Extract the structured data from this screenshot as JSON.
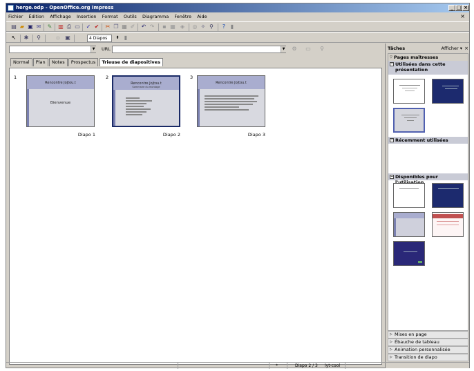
{
  "window": {
    "title": "herge.odp - OpenOffice.org Impress",
    "doc_close": "×",
    "controls": [
      "_",
      "□",
      "×"
    ]
  },
  "menu": [
    "Fichier",
    "Édition",
    "Affichage",
    "Insertion",
    "Format",
    "Outils",
    "Diagramma",
    "Fenêtre",
    "Aide"
  ],
  "toolbar2": {
    "zoom_value": "4 Diapos"
  },
  "hyperlink_bar": {
    "url_label": "URL :",
    "url_value": "",
    "text_value": ""
  },
  "tabs": [
    "Normal",
    "Plan",
    "Notes",
    "Prospectus",
    "Trieuse de diapositives"
  ],
  "active_tab": 4,
  "slides": [
    {
      "number": "1",
      "label": "Diapo 1",
      "title": "Rencontre Jojtou.t",
      "subtitle": "",
      "body": "Bienvenue"
    },
    {
      "number": "2",
      "label": "Diapo 2",
      "title": "Rencontre Jojtou.t",
      "subtitle": "Sommaire du montage",
      "body": ""
    },
    {
      "number": "3",
      "label": "Diapo 3",
      "title": "Rencontre Jojtou.t",
      "subtitle": "",
      "body": ""
    }
  ],
  "slide_selected": 1,
  "task_pane": {
    "title": "Tâches",
    "view_label": "Afficher",
    "close": "×",
    "master_pages": "Pages maîtresses",
    "used_section": "Utilisées dans cette présentation",
    "recent_section": "Récemment utilisées",
    "available_section": "Disponibles pour l'utilisation",
    "bottom_panels": [
      "Mises en page",
      "Ébauche de tableau",
      "Animation personnalisée",
      "Transition de diapo"
    ]
  },
  "status": {
    "modified": "*",
    "slide_info": "Diapo 2 / 3",
    "master": "lyt-cool"
  },
  "colors": {
    "title_start": "#0a246a",
    "title_end": "#a6caf0",
    "slide_header": "#a9adcf",
    "slide_bg": "#d8d9e0",
    "selected_border": "#1a2a66"
  }
}
